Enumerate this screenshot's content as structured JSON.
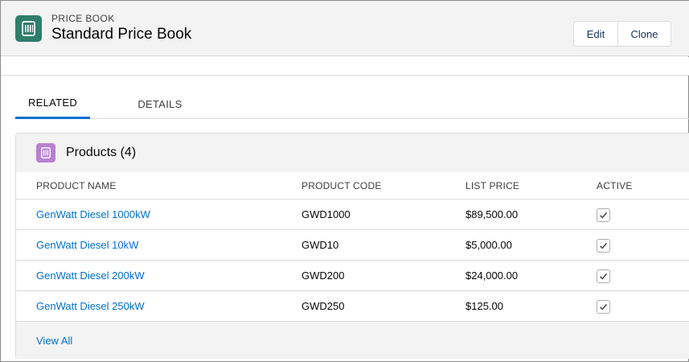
{
  "header": {
    "eyebrow": "PRICE BOOK",
    "title": "Standard Price Book",
    "icon": "price-book-icon",
    "actions": {
      "edit": "Edit",
      "clone": "Clone"
    }
  },
  "tabs": [
    {
      "label": "RELATED",
      "active": true
    },
    {
      "label": "DETAILS",
      "active": false
    }
  ],
  "products_card": {
    "title": "Products (4)",
    "icon": "product-icon",
    "columns": [
      "PRODUCT NAME",
      "PRODUCT CODE",
      "LIST PRICE",
      "ACTIVE"
    ],
    "rows": [
      {
        "name": "GenWatt Diesel 1000kW",
        "code": "GWD1000",
        "price": "$89,500.00",
        "active": true
      },
      {
        "name": "GenWatt Diesel 10kW",
        "code": "GWD10",
        "price": "$5,000.00",
        "active": true
      },
      {
        "name": "GenWatt Diesel 200kW",
        "code": "GWD200",
        "price": "$24,000.00",
        "active": true
      },
      {
        "name": "GenWatt Diesel 250kW",
        "code": "GWD250",
        "price": "$125.00",
        "active": true
      }
    ],
    "footer_link": "View All"
  },
  "colors": {
    "header_icon_bg": "#2f7d6d",
    "card_icon_bg": "#b781d3",
    "link": "#0070d2",
    "tab_active": "#0070d2"
  }
}
